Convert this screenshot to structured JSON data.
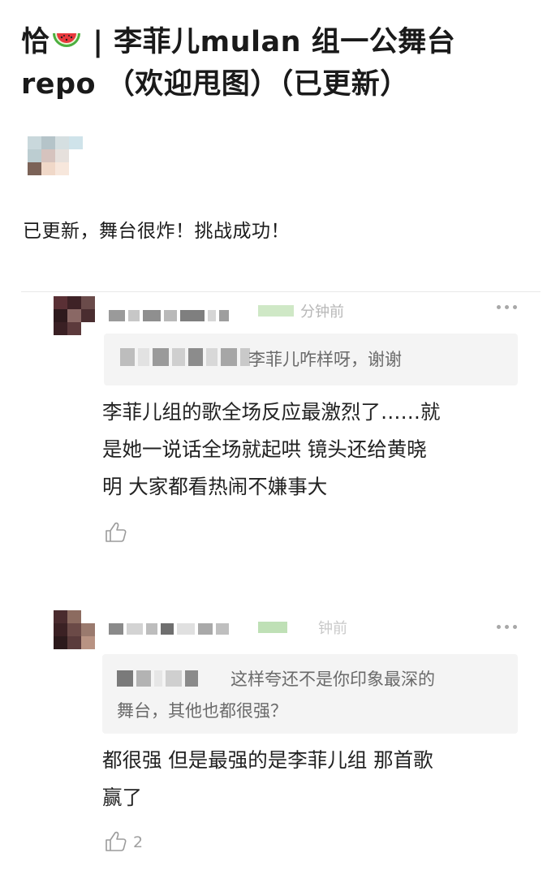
{
  "post": {
    "title_prefix": "恰",
    "title_rest": " | 李菲儿mulan 组一公舞台",
    "title_line2": "repo （欢迎甩图）（已更新）",
    "melon_icon": "watermelon-icon",
    "body": "已更新，舞台很炸！挑战成功！"
  },
  "comments": [
    {
      "time": "分钟前",
      "quote": "李菲儿咋样呀，谢谢",
      "reply_lines": [
        "李菲儿组的歌全场反应最激烈了……就",
        "是她一说话全场就起哄 镜头还给黄晓",
        "明 大家都看热闹不嫌事大"
      ],
      "likes": ""
    },
    {
      "time": "钟前",
      "quote_line1": "这样夸还不是你印象最深的",
      "quote_line2": "舞台，其他也都很强？",
      "reply_lines": [
        "都很强 但是最强的是李菲儿组 那首歌",
        "赢了"
      ],
      "likes": "2"
    }
  ],
  "colors": {
    "text": "#222222",
    "muted": "#b7b7b7",
    "quote_bg": "#f4f4f4"
  }
}
